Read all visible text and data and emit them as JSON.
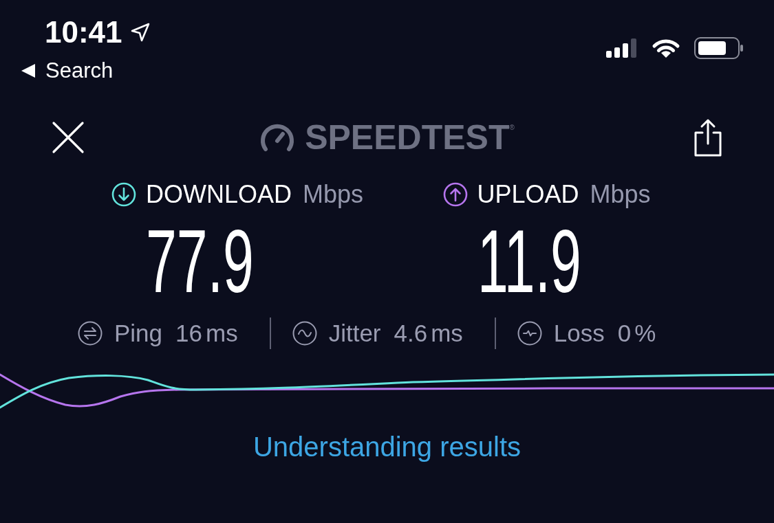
{
  "status_bar": {
    "time": "10:41",
    "back_label": "Search"
  },
  "header": {
    "logo_text": "SPEEDTEST",
    "logo_mark": "®"
  },
  "results": [
    {
      "kind": "download",
      "label": "DOWNLOAD",
      "unit": "Mbps",
      "value": "77.9",
      "color": "#62e3dc"
    },
    {
      "kind": "upload",
      "label": "UPLOAD",
      "unit": "Mbps",
      "value": "11.9",
      "color": "#b675ee"
    }
  ],
  "stats": [
    {
      "kind": "ping",
      "label": "Ping",
      "value": "16",
      "unit": "ms"
    },
    {
      "kind": "jitter",
      "label": "Jitter",
      "value": "4.6",
      "unit": "ms"
    },
    {
      "kind": "loss",
      "label": "Loss",
      "value": "0",
      "unit": "%"
    }
  ],
  "link": "Understanding results"
}
